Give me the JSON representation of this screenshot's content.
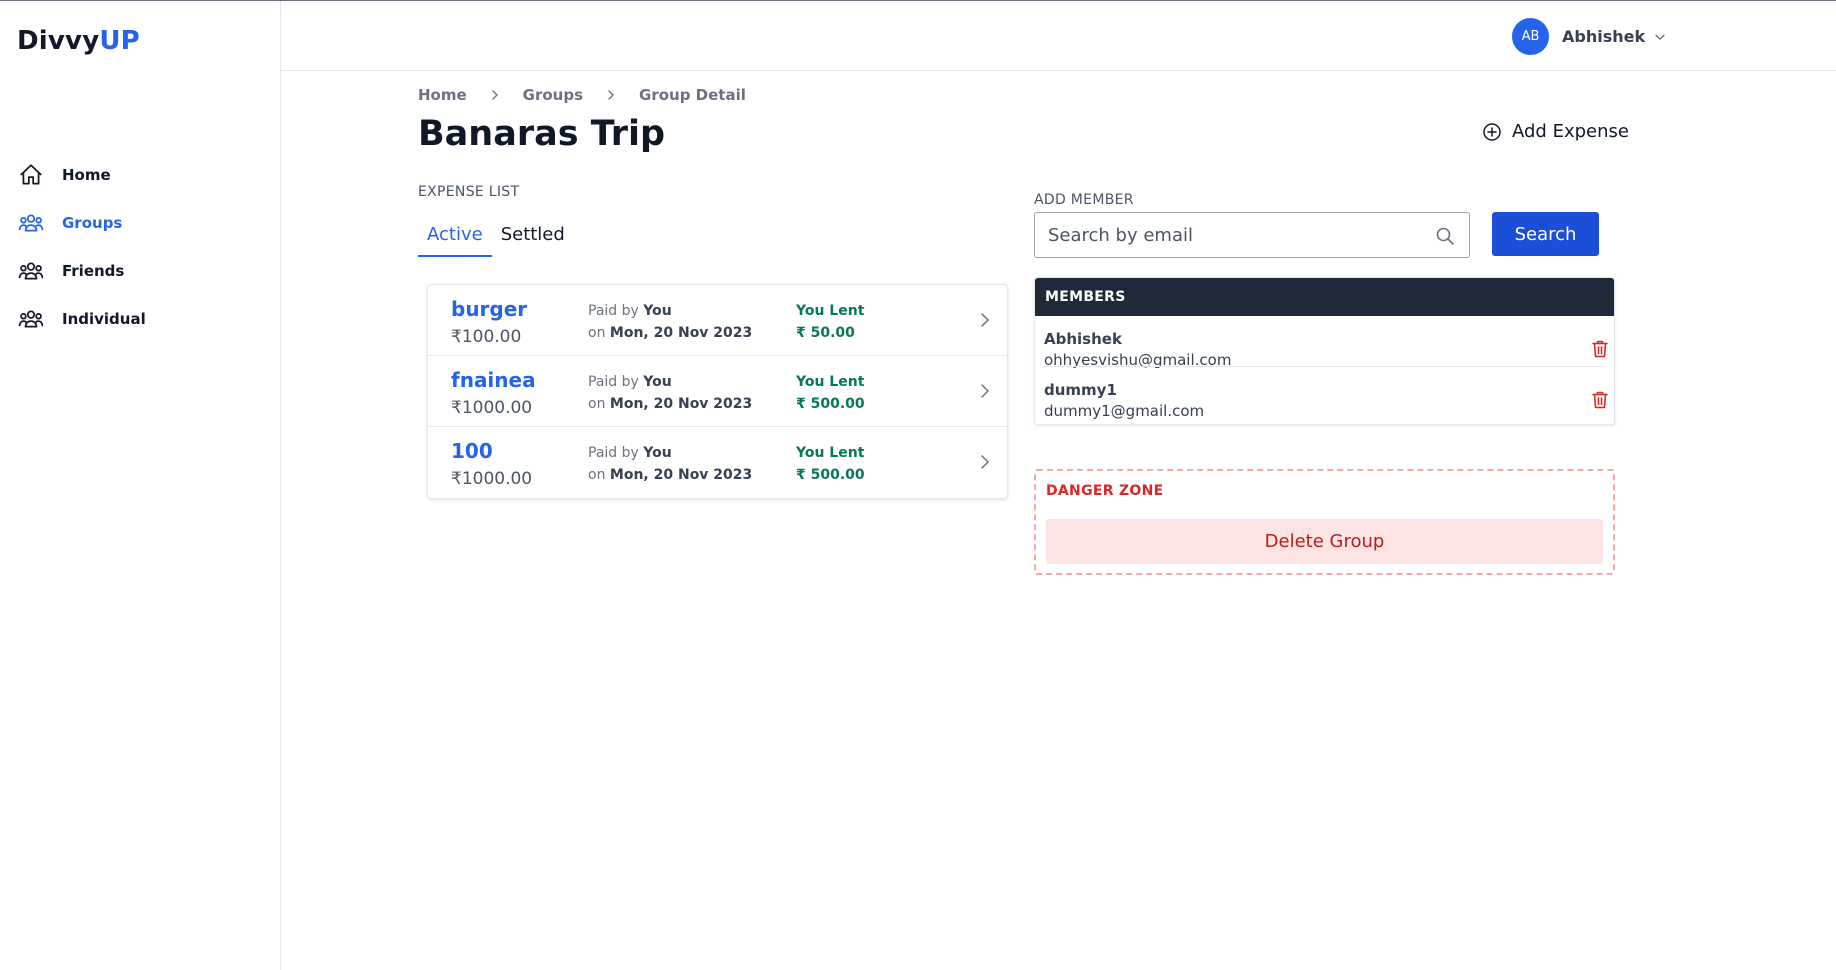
{
  "app": {
    "logo_main": "Divvy",
    "logo_accent": "UP"
  },
  "colors": {
    "accent": "#2563eb",
    "success": "#047857",
    "danger": "#dc2626",
    "members_header_bg": "#1f2937"
  },
  "sidebar": {
    "items": [
      {
        "label": "Home",
        "icon": "home-icon",
        "active": false
      },
      {
        "label": "Groups",
        "icon": "groups-icon",
        "active": true
      },
      {
        "label": "Friends",
        "icon": "friends-icon",
        "active": false
      },
      {
        "label": "Individual",
        "icon": "individual-icon",
        "active": false
      }
    ]
  },
  "header": {
    "avatar_initials": "AB",
    "user_name": "Abhishek"
  },
  "breadcrumb": [
    "Home",
    "Groups",
    "Group Detail"
  ],
  "page": {
    "title": "Banaras Trip",
    "add_expense_label": "Add Expense"
  },
  "expenses": {
    "section_label": "EXPENSE LIST",
    "tabs": [
      {
        "label": "Active",
        "active": true
      },
      {
        "label": "Settled",
        "active": false
      }
    ],
    "items": [
      {
        "name": "burger",
        "amount": "₹100.00",
        "paid_prefix": "Paid by",
        "paid_by": "You",
        "date_prefix": "on",
        "date": "Mon, 20 Nov 2023",
        "status": "You Lent",
        "lent_amount": "₹ 50.00"
      },
      {
        "name": "fnainea",
        "amount": "₹1000.00",
        "paid_prefix": "Paid by",
        "paid_by": "You",
        "date_prefix": "on",
        "date": "Mon, 20 Nov 2023",
        "status": "You Lent",
        "lent_amount": "₹ 500.00"
      },
      {
        "name": "100",
        "amount": "₹1000.00",
        "paid_prefix": "Paid by",
        "paid_by": "You",
        "date_prefix": "on",
        "date": "Mon, 20 Nov 2023",
        "status": "You Lent",
        "lent_amount": "₹ 500.00"
      }
    ]
  },
  "add_member": {
    "label": "ADD MEMBER",
    "placeholder": "Search by email",
    "value": "",
    "button_label": "Search"
  },
  "members": {
    "header": "MEMBERS",
    "items": [
      {
        "name": "Abhishek",
        "email": "ohhyesvishu@gmail.com"
      },
      {
        "name": "dummy1",
        "email": "dummy1@gmail.com"
      }
    ]
  },
  "danger_zone": {
    "title": "DANGER ZONE",
    "delete_label": "Delete Group"
  }
}
